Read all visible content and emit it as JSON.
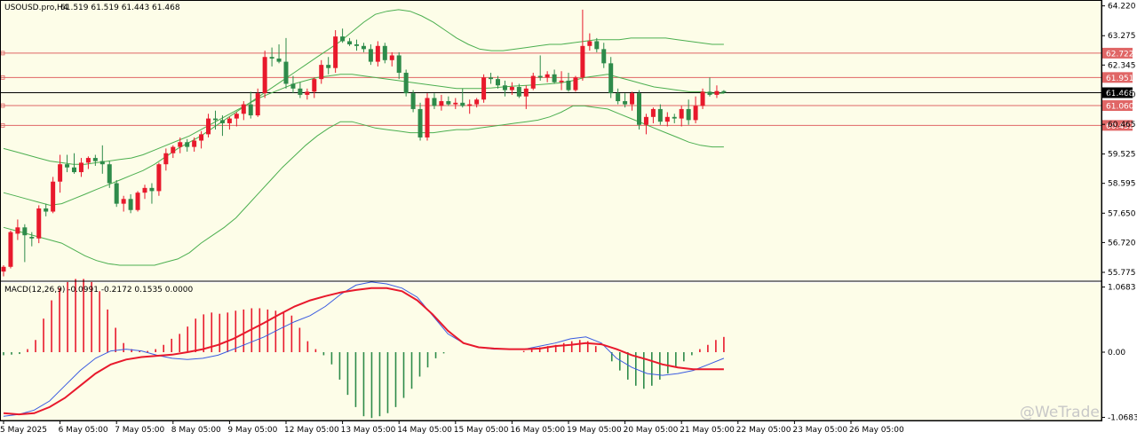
{
  "header": {
    "symbol_label": "USOUSD.pro,H4",
    "ohlc_label": "61.519 61.519 61.443 61.468",
    "indicator_label": "MACD(12,26,9) -0.0991 -0.2172 0.1535 0.0000"
  },
  "watermark": "@WeTrade",
  "colors": {
    "background": "#fdfde8",
    "bull": "#e8192c",
    "bear": "#2e8b4a",
    "bollinger": "#4caf50",
    "level_line": "#e06666",
    "last_price": "#000000",
    "macd_line": "#3a5be0",
    "signal_line": "#e8192c"
  },
  "chart_data": [
    {
      "type": "candlestick",
      "symbol": "USOUSD.pro",
      "timeframe": "H4",
      "ylim": [
        55.55,
        64.35
      ],
      "y_ticks": [
        64.22,
        63.275,
        62.345,
        61.41,
        60.465,
        59.525,
        58.595,
        57.65,
        56.72,
        55.775
      ],
      "x_tick_labels": [
        "5 May 2025",
        "6 May 05:00",
        "7 May 05:00",
        "8 May 05:00",
        "9 May 05:00",
        "12 May 05:00",
        "13 May 05:00",
        "14 May 05:00",
        "15 May 05:00",
        "16 May 05:00",
        "19 May 05:00",
        "20 May 05:00",
        "21 May 05:00",
        "22 May 05:00",
        "23 May 05:00",
        "26 May 05:00"
      ],
      "x_tick_index": [
        0,
        8,
        16,
        24,
        32,
        40,
        48,
        56,
        64,
        72,
        80,
        88,
        96,
        104,
        112,
        120
      ],
      "price_levels": [
        62.722,
        61.951,
        61.06,
        60.432
      ],
      "last_price": 61.468,
      "candles": [
        {
          "o": 55.8,
          "h": 56.0,
          "l": 55.65,
          "c": 55.95
        },
        {
          "o": 55.95,
          "h": 57.1,
          "l": 55.9,
          "c": 57.05
        },
        {
          "o": 57.0,
          "h": 57.45,
          "l": 56.8,
          "c": 57.2
        },
        {
          "o": 57.2,
          "h": 57.3,
          "l": 56.1,
          "c": 56.95
        },
        {
          "o": 56.9,
          "h": 57.05,
          "l": 56.6,
          "c": 56.85
        },
        {
          "o": 56.85,
          "h": 57.9,
          "l": 56.7,
          "c": 57.8
        },
        {
          "o": 57.8,
          "h": 57.95,
          "l": 57.55,
          "c": 57.7
        },
        {
          "o": 57.7,
          "h": 58.8,
          "l": 57.65,
          "c": 58.65
        },
        {
          "o": 58.65,
          "h": 59.5,
          "l": 58.3,
          "c": 59.2
        },
        {
          "o": 59.2,
          "h": 59.5,
          "l": 58.95,
          "c": 59.1
        },
        {
          "o": 59.1,
          "h": 59.55,
          "l": 58.9,
          "c": 58.95
        },
        {
          "o": 58.95,
          "h": 59.4,
          "l": 58.8,
          "c": 59.25
        },
        {
          "o": 59.25,
          "h": 59.45,
          "l": 59.05,
          "c": 59.4
        },
        {
          "o": 59.4,
          "h": 59.5,
          "l": 59.15,
          "c": 59.3
        },
        {
          "o": 59.3,
          "h": 59.8,
          "l": 58.9,
          "c": 59.2
        },
        {
          "o": 59.2,
          "h": 59.3,
          "l": 58.45,
          "c": 58.6
        },
        {
          "o": 58.6,
          "h": 58.7,
          "l": 57.85,
          "c": 57.95
        },
        {
          "o": 57.95,
          "h": 58.2,
          "l": 57.7,
          "c": 58.1
        },
        {
          "o": 58.1,
          "h": 58.25,
          "l": 57.65,
          "c": 57.75
        },
        {
          "o": 57.75,
          "h": 58.35,
          "l": 57.7,
          "c": 58.3
        },
        {
          "o": 58.3,
          "h": 58.55,
          "l": 58.1,
          "c": 58.45
        },
        {
          "o": 58.45,
          "h": 58.6,
          "l": 57.95,
          "c": 58.35
        },
        {
          "o": 58.35,
          "h": 59.25,
          "l": 58.2,
          "c": 59.2
        },
        {
          "o": 59.2,
          "h": 59.7,
          "l": 59.0,
          "c": 59.55
        },
        {
          "o": 59.55,
          "h": 59.8,
          "l": 59.4,
          "c": 59.75
        },
        {
          "o": 59.75,
          "h": 60.05,
          "l": 59.55,
          "c": 59.9
        },
        {
          "o": 59.9,
          "h": 60.0,
          "l": 59.6,
          "c": 59.75
        },
        {
          "o": 59.75,
          "h": 60.05,
          "l": 59.6,
          "c": 59.95
        },
        {
          "o": 59.95,
          "h": 60.25,
          "l": 59.7,
          "c": 60.15
        },
        {
          "o": 60.15,
          "h": 60.8,
          "l": 60.05,
          "c": 60.65
        },
        {
          "o": 60.65,
          "h": 60.9,
          "l": 60.3,
          "c": 60.6
        },
        {
          "o": 60.6,
          "h": 60.75,
          "l": 60.1,
          "c": 60.5
        },
        {
          "o": 60.5,
          "h": 60.7,
          "l": 60.3,
          "c": 60.65
        },
        {
          "o": 60.65,
          "h": 60.85,
          "l": 60.4,
          "c": 60.8
        },
        {
          "o": 60.8,
          "h": 61.2,
          "l": 60.6,
          "c": 61.1
        },
        {
          "o": 61.1,
          "h": 61.5,
          "l": 60.65,
          "c": 60.75
        },
        {
          "o": 60.75,
          "h": 61.6,
          "l": 60.7,
          "c": 61.45
        },
        {
          "o": 61.45,
          "h": 62.8,
          "l": 61.3,
          "c": 62.6
        },
        {
          "o": 62.6,
          "h": 62.9,
          "l": 62.3,
          "c": 62.55
        },
        {
          "o": 62.55,
          "h": 63.0,
          "l": 62.4,
          "c": 62.45
        },
        {
          "o": 62.45,
          "h": 63.2,
          "l": 61.6,
          "c": 61.75
        },
        {
          "o": 61.75,
          "h": 62.0,
          "l": 61.45,
          "c": 61.6
        },
        {
          "o": 61.6,
          "h": 61.8,
          "l": 61.3,
          "c": 61.4
        },
        {
          "o": 61.4,
          "h": 61.6,
          "l": 61.25,
          "c": 61.5
        },
        {
          "o": 61.5,
          "h": 61.95,
          "l": 61.3,
          "c": 61.9
        },
        {
          "o": 61.9,
          "h": 62.5,
          "l": 61.75,
          "c": 62.35
        },
        {
          "o": 62.35,
          "h": 62.6,
          "l": 62.05,
          "c": 62.25
        },
        {
          "o": 62.25,
          "h": 63.45,
          "l": 62.1,
          "c": 63.25
        },
        {
          "o": 63.25,
          "h": 63.5,
          "l": 63.05,
          "c": 63.1
        },
        {
          "o": 63.1,
          "h": 63.2,
          "l": 62.95,
          "c": 63.0
        },
        {
          "o": 63.0,
          "h": 63.15,
          "l": 62.8,
          "c": 62.95
        },
        {
          "o": 62.95,
          "h": 63.05,
          "l": 62.75,
          "c": 62.85
        },
        {
          "o": 62.85,
          "h": 63.0,
          "l": 62.35,
          "c": 62.45
        },
        {
          "o": 62.45,
          "h": 63.1,
          "l": 62.3,
          "c": 62.95
        },
        {
          "o": 62.95,
          "h": 63.05,
          "l": 62.4,
          "c": 62.5
        },
        {
          "o": 62.5,
          "h": 62.75,
          "l": 62.3,
          "c": 62.65
        },
        {
          "o": 62.65,
          "h": 62.75,
          "l": 61.9,
          "c": 62.1
        },
        {
          "o": 62.1,
          "h": 62.2,
          "l": 61.35,
          "c": 61.45
        },
        {
          "o": 61.45,
          "h": 61.55,
          "l": 60.85,
          "c": 60.95
        },
        {
          "o": 60.95,
          "h": 61.15,
          "l": 59.95,
          "c": 60.05
        },
        {
          "o": 60.05,
          "h": 61.45,
          "l": 59.95,
          "c": 61.3
        },
        {
          "o": 61.3,
          "h": 61.45,
          "l": 60.95,
          "c": 61.05
        },
        {
          "o": 61.05,
          "h": 61.4,
          "l": 60.9,
          "c": 61.2
        },
        {
          "o": 61.2,
          "h": 61.35,
          "l": 61.05,
          "c": 61.1
        },
        {
          "o": 61.1,
          "h": 61.3,
          "l": 60.95,
          "c": 61.15
        },
        {
          "o": 61.15,
          "h": 61.6,
          "l": 61.0,
          "c": 61.05
        },
        {
          "o": 61.05,
          "h": 61.25,
          "l": 60.8,
          "c": 61.1
        },
        {
          "o": 61.1,
          "h": 61.3,
          "l": 61.0,
          "c": 61.25
        },
        {
          "o": 61.25,
          "h": 62.05,
          "l": 61.15,
          "c": 61.95
        },
        {
          "o": 61.95,
          "h": 62.1,
          "l": 61.75,
          "c": 61.9
        },
        {
          "o": 61.9,
          "h": 62.0,
          "l": 61.6,
          "c": 61.7
        },
        {
          "o": 61.7,
          "h": 61.85,
          "l": 61.35,
          "c": 61.55
        },
        {
          "o": 61.55,
          "h": 61.8,
          "l": 61.4,
          "c": 61.65
        },
        {
          "o": 61.65,
          "h": 61.75,
          "l": 61.3,
          "c": 61.35
        },
        {
          "o": 61.35,
          "h": 61.7,
          "l": 60.95,
          "c": 61.6
        },
        {
          "o": 61.6,
          "h": 62.1,
          "l": 61.55,
          "c": 62.0
        },
        {
          "o": 62.0,
          "h": 62.65,
          "l": 61.85,
          "c": 61.95
        },
        {
          "o": 61.95,
          "h": 62.15,
          "l": 61.8,
          "c": 62.05
        },
        {
          "o": 62.05,
          "h": 62.2,
          "l": 61.75,
          "c": 61.8
        },
        {
          "o": 61.8,
          "h": 62.15,
          "l": 61.55,
          "c": 61.85
        },
        {
          "o": 61.85,
          "h": 62.1,
          "l": 61.5,
          "c": 61.55
        },
        {
          "o": 61.55,
          "h": 62.0,
          "l": 61.5,
          "c": 61.95
        },
        {
          "o": 61.95,
          "h": 64.1,
          "l": 61.85,
          "c": 62.95
        },
        {
          "o": 62.95,
          "h": 63.35,
          "l": 62.8,
          "c": 63.1
        },
        {
          "o": 63.1,
          "h": 63.2,
          "l": 62.75,
          "c": 62.85
        },
        {
          "o": 62.85,
          "h": 63.05,
          "l": 62.25,
          "c": 62.4
        },
        {
          "o": 62.4,
          "h": 62.6,
          "l": 61.3,
          "c": 61.45
        },
        {
          "o": 61.45,
          "h": 61.6,
          "l": 61.1,
          "c": 61.2
        },
        {
          "o": 61.2,
          "h": 61.45,
          "l": 61.0,
          "c": 61.1
        },
        {
          "o": 61.1,
          "h": 61.5,
          "l": 60.9,
          "c": 61.45
        },
        {
          "o": 61.45,
          "h": 61.55,
          "l": 60.3,
          "c": 60.45
        },
        {
          "o": 60.45,
          "h": 60.8,
          "l": 60.15,
          "c": 60.7
        },
        {
          "o": 60.7,
          "h": 61.0,
          "l": 60.5,
          "c": 60.95
        },
        {
          "o": 60.95,
          "h": 61.1,
          "l": 60.45,
          "c": 60.55
        },
        {
          "o": 60.55,
          "h": 60.85,
          "l": 60.4,
          "c": 60.7
        },
        {
          "o": 60.7,
          "h": 60.8,
          "l": 60.5,
          "c": 60.65
        },
        {
          "o": 60.65,
          "h": 61.05,
          "l": 60.4,
          "c": 60.95
        },
        {
          "o": 60.95,
          "h": 61.25,
          "l": 60.45,
          "c": 60.6
        },
        {
          "o": 60.6,
          "h": 61.35,
          "l": 60.5,
          "c": 61.05
        },
        {
          "o": 61.05,
          "h": 61.6,
          "l": 60.95,
          "c": 61.5
        },
        {
          "o": 61.5,
          "h": 61.95,
          "l": 61.35,
          "c": 61.4
        },
        {
          "o": 61.4,
          "h": 61.7,
          "l": 61.3,
          "c": 61.52
        },
        {
          "o": 61.52,
          "h": 61.55,
          "l": 61.44,
          "c": 61.468
        }
      ],
      "bollinger_upper": [
        58.3,
        58.2,
        58.1,
        58.0,
        57.9,
        57.95,
        58.1,
        58.25,
        58.4,
        58.55,
        58.7,
        58.85,
        59.0,
        59.2,
        59.45,
        59.7,
        59.9,
        60.1,
        60.35,
        60.6,
        60.85,
        61.1,
        61.35,
        61.6,
        61.85,
        62.1,
        62.35,
        62.6,
        62.85,
        63.1,
        63.4,
        63.7,
        63.95,
        64.05,
        64.1,
        64.05,
        63.9,
        63.7,
        63.45,
        63.2,
        63.0,
        62.85,
        62.8,
        62.8,
        62.85,
        62.9,
        62.95,
        63.0,
        63.0,
        63.05,
        63.1,
        63.15,
        63.15,
        63.15,
        63.2,
        63.2,
        63.2,
        63.2,
        63.15,
        63.1,
        63.05,
        63.0,
        63.0
      ],
      "bollinger_middle": [
        59.7,
        59.6,
        59.5,
        59.4,
        59.3,
        59.25,
        59.2,
        59.2,
        59.25,
        59.3,
        59.35,
        59.4,
        59.5,
        59.65,
        59.8,
        59.95,
        60.1,
        60.3,
        60.5,
        60.7,
        60.9,
        61.1,
        61.3,
        61.45,
        61.6,
        61.75,
        61.85,
        61.95,
        62.0,
        62.05,
        62.05,
        62.0,
        61.95,
        61.9,
        61.85,
        61.8,
        61.75,
        61.7,
        61.65,
        61.6,
        61.6,
        61.6,
        61.62,
        61.65,
        61.68,
        61.7,
        61.72,
        61.75,
        61.78,
        61.85,
        61.95,
        62.0,
        62.05,
        61.95,
        61.85,
        61.75,
        61.65,
        61.6,
        61.55,
        61.5,
        61.5,
        61.45,
        61.45
      ],
      "bollinger_lower": [
        57.2,
        57.1,
        57.0,
        56.9,
        56.8,
        56.7,
        56.5,
        56.3,
        56.15,
        56.05,
        56.0,
        56.0,
        56.0,
        56.0,
        56.1,
        56.2,
        56.4,
        56.7,
        56.95,
        57.2,
        57.5,
        57.9,
        58.3,
        58.7,
        59.1,
        59.45,
        59.8,
        60.1,
        60.35,
        60.55,
        60.55,
        60.45,
        60.35,
        60.3,
        60.25,
        60.2,
        60.2,
        60.2,
        60.25,
        60.3,
        60.3,
        60.35,
        60.4,
        60.45,
        60.5,
        60.55,
        60.6,
        60.7,
        60.85,
        61.05,
        61.05,
        61.0,
        60.95,
        60.8,
        60.65,
        60.5,
        60.35,
        60.2,
        60.05,
        59.9,
        59.8,
        59.75,
        59.75
      ]
    },
    {
      "type": "macd",
      "title": "MACD(12,26,9)",
      "values_label": "-0.0991 -0.2172 0.1535 0.0000",
      "ylim": [
        -1.12,
        1.12
      ],
      "y_ticks": [
        1.0683,
        0.0,
        -1.0683
      ],
      "histogram": [
        -0.05,
        -0.04,
        -0.03,
        0.05,
        0.2,
        0.55,
        0.85,
        1.05,
        1.15,
        1.2,
        1.2,
        1.15,
        1.0,
        0.7,
        0.4,
        0.15,
        0.05,
        0.02,
        0.02,
        0.05,
        0.12,
        0.22,
        0.3,
        0.42,
        0.55,
        0.62,
        0.65,
        0.63,
        0.65,
        0.68,
        0.7,
        0.72,
        0.72,
        0.7,
        0.68,
        0.65,
        0.6,
        0.4,
        0.18,
        0.05,
        -0.05,
        -0.2,
        -0.45,
        -0.7,
        -0.9,
        -1.05,
        -1.08,
        -1.05,
        -1.0,
        -0.9,
        -0.75,
        -0.6,
        -0.4,
        -0.25,
        -0.1,
        -0.02,
        0.0,
        0.0,
        0.0,
        0.0,
        0.0,
        0.0,
        0.0,
        0.0,
        0.0,
        0.02,
        0.05,
        0.08,
        0.1,
        0.12,
        0.15,
        0.18,
        0.2,
        0.18,
        0.1,
        0.0,
        -0.15,
        -0.3,
        -0.45,
        -0.55,
        -0.6,
        -0.55,
        -0.45,
        -0.35,
        -0.25,
        -0.15,
        -0.05,
        0.05,
        0.12,
        0.2,
        0.25
      ],
      "macd_line": [
        -1.05,
        -1.02,
        -0.95,
        -0.8,
        -0.55,
        -0.3,
        -0.1,
        0.02,
        0.05,
        0.02,
        -0.05,
        -0.1,
        -0.12,
        -0.1,
        -0.05,
        0.05,
        0.15,
        0.25,
        0.38,
        0.5,
        0.6,
        0.75,
        0.95,
        1.1,
        1.15,
        1.12,
        1.05,
        0.9,
        0.6,
        0.3,
        0.15,
        0.08,
        0.05,
        0.05,
        0.05,
        0.1,
        0.15,
        0.22,
        0.25,
        0.15,
        -0.1,
        -0.25,
        -0.35,
        -0.38,
        -0.35,
        -0.3,
        -0.2,
        -0.1
      ],
      "signal_line": [
        -1.0,
        -1.02,
        -1.0,
        -0.9,
        -0.75,
        -0.55,
        -0.35,
        -0.2,
        -0.12,
        -0.08,
        -0.06,
        -0.04,
        0.0,
        0.05,
        0.12,
        0.22,
        0.35,
        0.48,
        0.62,
        0.75,
        0.85,
        0.92,
        0.98,
        1.02,
        1.05,
        1.05,
        1.0,
        0.85,
        0.62,
        0.35,
        0.15,
        0.08,
        0.06,
        0.05,
        0.05,
        0.06,
        0.1,
        0.12,
        0.15,
        0.13,
        0.05,
        -0.05,
        -0.12,
        -0.2,
        -0.25,
        -0.28,
        -0.28,
        -0.28
      ]
    }
  ]
}
